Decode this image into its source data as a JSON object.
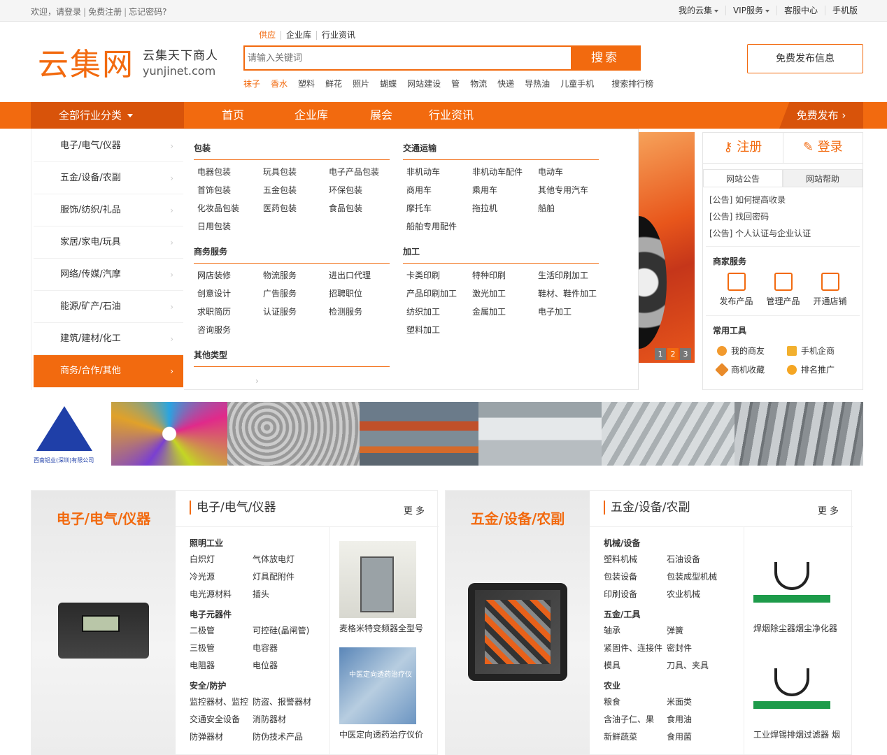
{
  "topbar": {
    "welcome": "欢迎，",
    "login": "请登录",
    "register": "免费注册",
    "forgot": "忘记密码?",
    "right": [
      {
        "label": "我的云集",
        "dropdown": true
      },
      {
        "label": "VIP服务",
        "dropdown": true
      },
      {
        "label": "客服中心",
        "dropdown": false
      },
      {
        "label": "手机版",
        "dropdown": false
      }
    ]
  },
  "logo": {
    "cn": "云集网",
    "slogan": "云集天下商人",
    "domain": "yunjinet.com"
  },
  "search": {
    "tabs": [
      "供应",
      "企业库",
      "行业资讯"
    ],
    "placeholder": "请输入关键词",
    "button": "搜索",
    "hotwords": [
      "袜子",
      "香水",
      "塑料",
      "鲜花",
      "照片",
      "蝴蝶",
      "网站建设",
      "管",
      "物流",
      "快递",
      "导热油",
      "儿童手机"
    ],
    "rank": "搜索排行榜"
  },
  "publish_button": "免费发布信息",
  "nav": {
    "all": "全部行业分类",
    "items": [
      "首页",
      "企业库",
      "展会",
      "行业资讯"
    ],
    "free": "免费发布"
  },
  "categories": [
    "电子/电气/仪器",
    "五金/设备/农副",
    "服饰/纺织/礼品",
    "家居/家电/玩具",
    "网络/传媒/汽摩",
    "能源/矿产/石油",
    "建筑/建材/化工",
    "商务/合作/其他"
  ],
  "panel": {
    "sections": [
      {
        "title": "包装",
        "items": [
          "电器包装",
          "玩具包装",
          "电子产品包装",
          "首饰包装",
          "五金包装",
          "环保包装",
          "化妆品包装",
          "医药包装",
          "食品包装",
          "日用包装"
        ]
      },
      {
        "title": "交通运输",
        "items": [
          "非机动车",
          "非机动车配件",
          "电动车",
          "商用车",
          "乘用车",
          "其他专用汽车",
          "摩托车",
          "拖拉机",
          "船舶",
          "船舶专用配件"
        ]
      },
      {
        "title": "商务服务",
        "items": [
          "网店装修",
          "物流服务",
          "进出口代理",
          "创意设计",
          "广告服务",
          "招聘职位",
          "求职简历",
          "认证服务",
          "检测服务",
          "咨询服务"
        ]
      },
      {
        "title": "加工",
        "items": [
          "卡类印刷",
          "特种印刷",
          "生活印刷加工",
          "产品印刷加工",
          "激光加工",
          "鞋材、鞋件加工",
          "纺织加工",
          "金属加工",
          "电子加工",
          "塑料加工"
        ]
      },
      {
        "title": "其他类型",
        "items": []
      }
    ]
  },
  "pager": [
    "1",
    "2",
    "3"
  ],
  "userbox": {
    "register": "注册",
    "login": "登录",
    "tabs": [
      "网站公告",
      "网站帮助"
    ],
    "notices": [
      "[公告] 如何提高收录",
      "[公告] 找回密码",
      "[公告] 个人认证与企业认证"
    ],
    "merchant_title": "商家服务",
    "services": [
      "发布产品",
      "管理产品",
      "开通店铺"
    ],
    "tools_title": "常用工具",
    "tools": [
      "我的商友",
      "手机企商",
      "商机收藏",
      "排名推广"
    ]
  },
  "strip": {
    "company": "西南铝业(深圳)有限公司"
  },
  "sections": [
    {
      "big": "电子/电气/仪器",
      "title": "电子/电气/仪器",
      "more": "更 多",
      "groups": [
        {
          "title": "照明工业",
          "items": [
            "白炽灯",
            "气体放电灯",
            "冷光源",
            "灯具配附件",
            "电光源材料",
            "插头"
          ]
        },
        {
          "title": "电子元器件",
          "items": [
            "二极管",
            "可控硅(晶闸管)",
            "三极管",
            "电容器",
            "电阻器",
            "电位器"
          ]
        },
        {
          "title": "安全/防护",
          "items": [
            "监控器材、监控",
            "防盗、报警器材",
            "交通安全设备",
            "消防器材",
            "防弹器材",
            "防伪技术产品"
          ]
        }
      ],
      "products": [
        "麦格米特变频器全型号",
        "中医定向透药治疗仪价"
      ],
      "product_overlay": "中医定向透药治疗仪"
    },
    {
      "big": "五金/设备/农副",
      "title": "五金/设备/农副",
      "more": "更 多",
      "groups": [
        {
          "title": "机械/设备",
          "items": [
            "塑料机械",
            "石油设备",
            "包装设备",
            "包装成型机械",
            "印刷设备",
            "农业机械"
          ]
        },
        {
          "title": "五金/工具",
          "items": [
            "轴承",
            "弹簧",
            "紧固件、连接件",
            "密封件",
            "模具",
            "刀具、夹具"
          ]
        },
        {
          "title": "农业",
          "items": [
            "粮食",
            "米面类",
            "含油子仁、果",
            "食用油",
            "新鲜蔬菜",
            "食用菌"
          ]
        }
      ],
      "products": [
        "焊烟除尘器烟尘净化器",
        "工业焊锡排烟过滤器 烟"
      ]
    }
  ]
}
